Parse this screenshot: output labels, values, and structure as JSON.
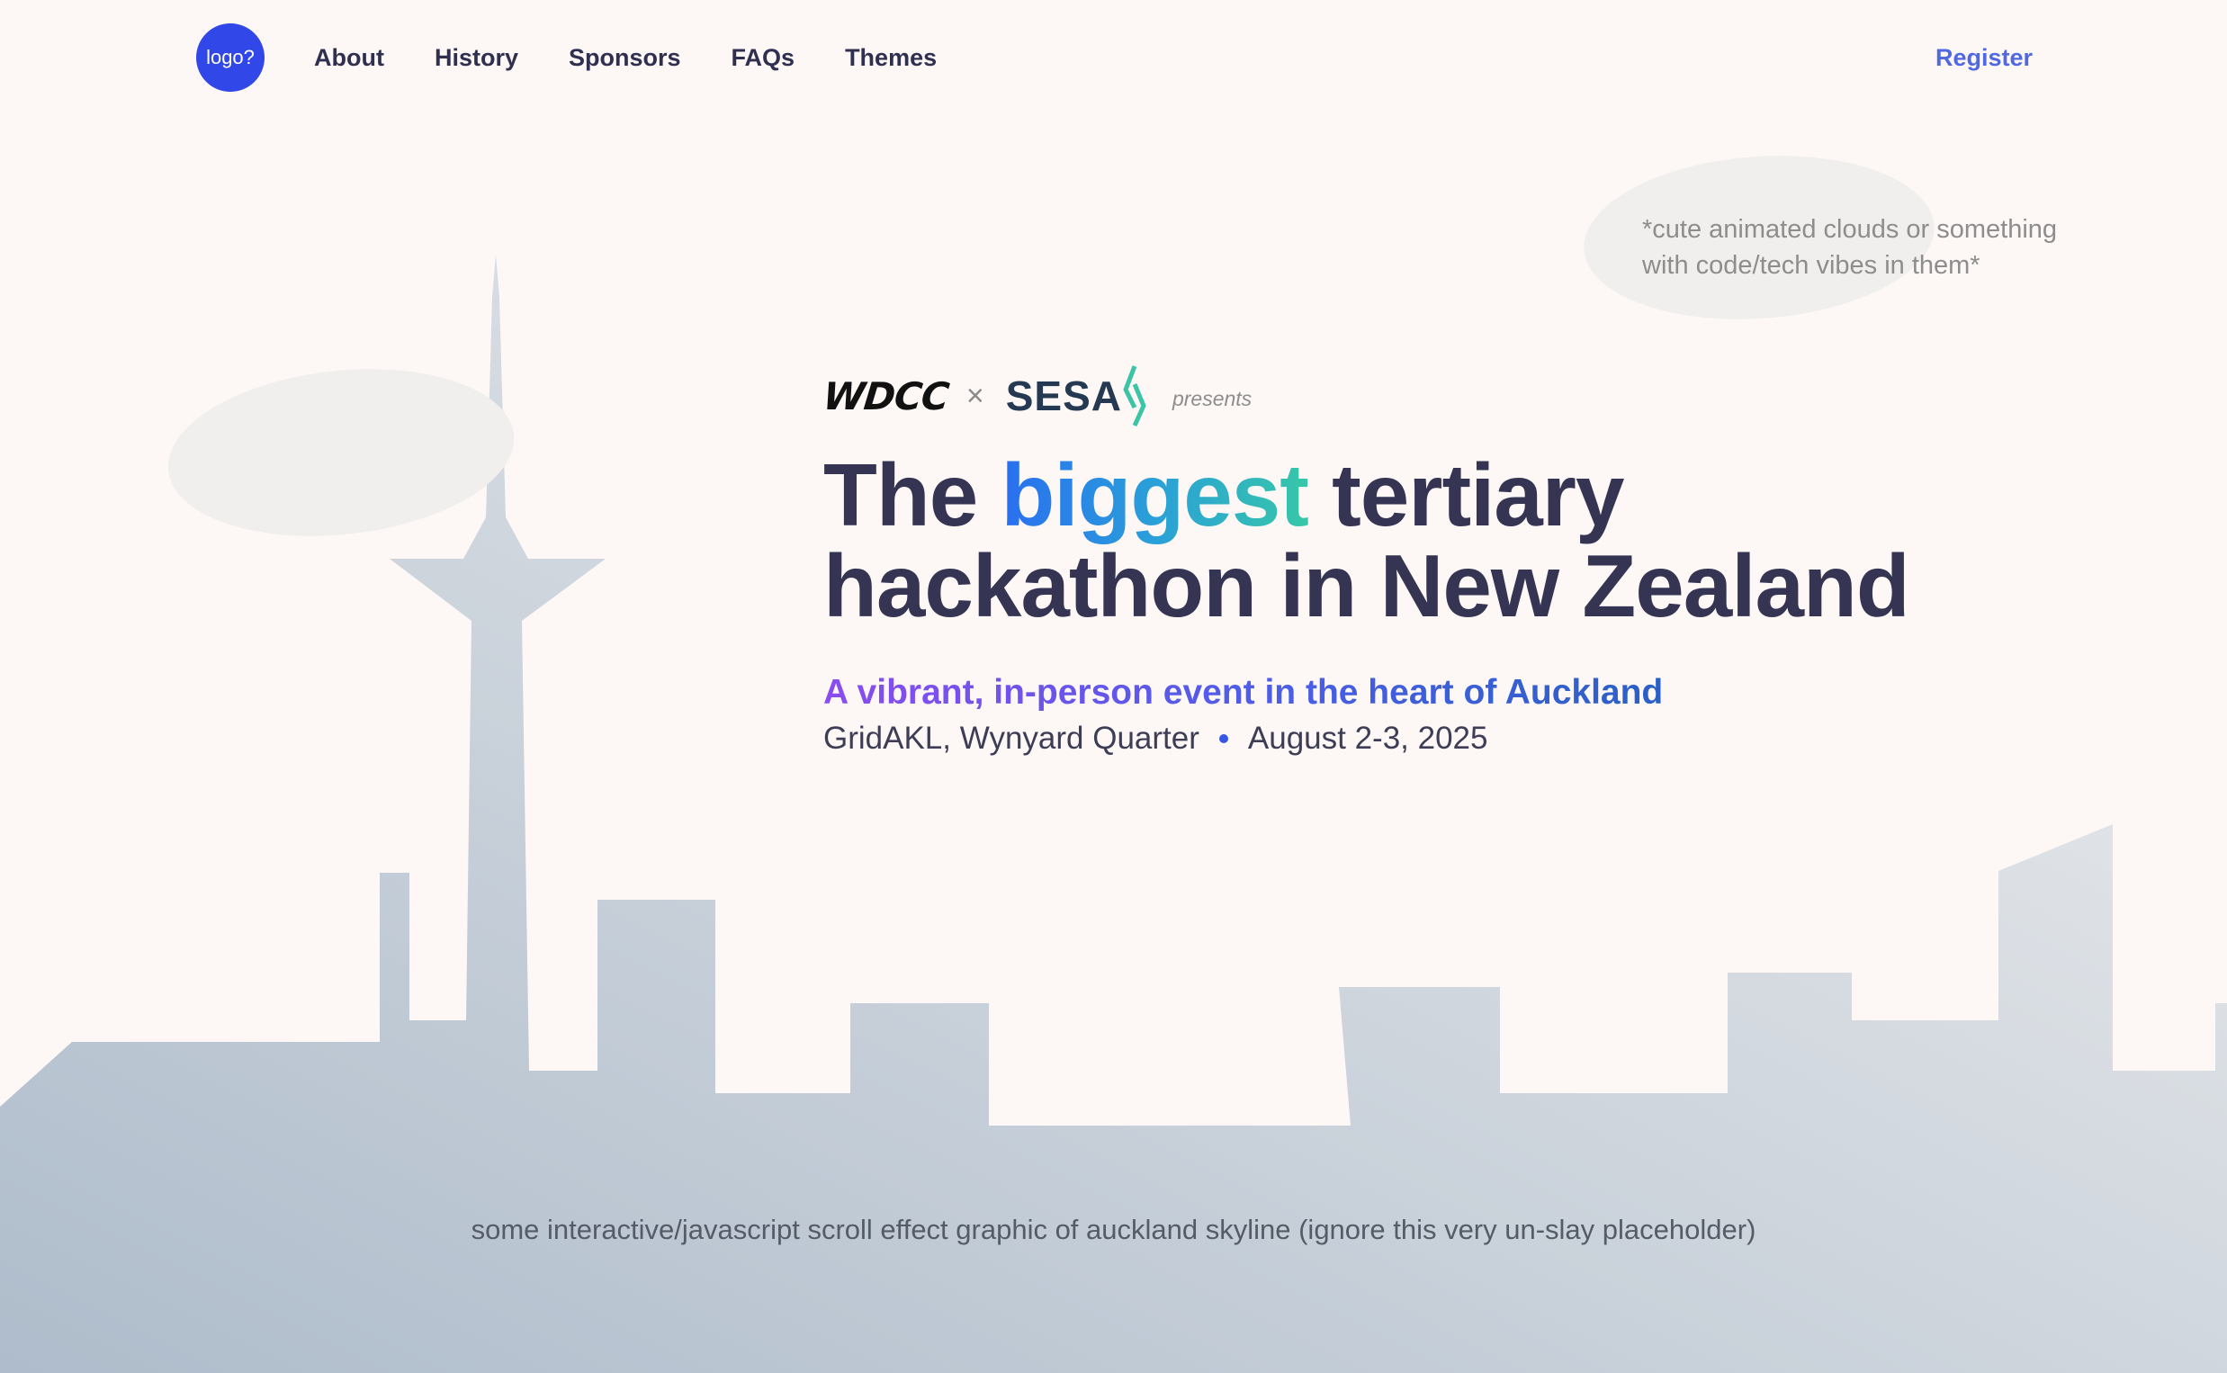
{
  "nav": {
    "logo_label": "logo?",
    "items": [
      {
        "label": "About"
      },
      {
        "label": "History"
      },
      {
        "label": "Sponsors"
      },
      {
        "label": "FAQs"
      },
      {
        "label": "Themes"
      }
    ],
    "register_label": "Register"
  },
  "cloud_note": "*cute animated clouds or something with code/tech vibes in them*",
  "hero": {
    "presenter_one": "WDCC",
    "separator": "×",
    "presenter_two": "SESA",
    "presents": "presents",
    "headline_pre": "The ",
    "headline_highlight": "biggest",
    "headline_post": " tertiary hackathon in New Zealand",
    "tagline": "A vibrant, in-person event in the heart of Auckland",
    "venue": "GridAKL, Wynyard Quarter",
    "date": "August 2-3, 2025"
  },
  "skyline_note": "some interactive/javascript scroll effect graphic of auckland skyline (ignore this very un-slay placeholder)",
  "colors": {
    "background": "#fdf8f6",
    "logo_blue": "#3147e8",
    "nav_text": "#2f3050",
    "register": "#5068e2",
    "headline": "#353452",
    "skyline_light": "#e8ebee",
    "skyline_dark": "#aebccb"
  },
  "icons": {
    "sesa_mark": "sesa-chevron-icon",
    "separator_dot": "bullet-dot-icon"
  }
}
